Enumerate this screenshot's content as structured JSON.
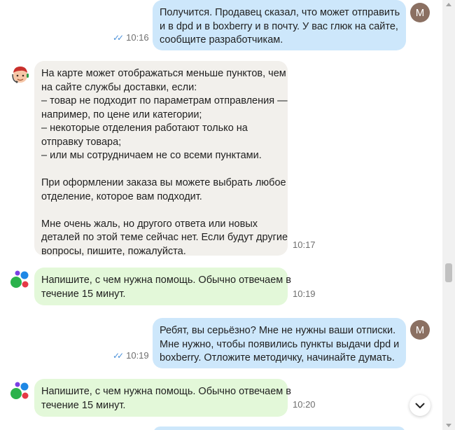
{
  "messages": [
    {
      "sender": "user",
      "avatar_letter": "М",
      "lines": [
        "Получится. Продавец сказал, что может отправить",
        "и в dpd и в boxberry и в почту. У вас глюк на сайте,",
        "сообщите разработчикам."
      ],
      "time": "10:16",
      "status_icon": "double-check-icon"
    },
    {
      "sender": "agent",
      "lines": [
        "На карте может отображаться меньше пунктов, чем",
        "на сайте службы доставки, если:",
        "– товар не подходит по параметрам отправления —",
        "например, по цене или категории;",
        "– некоторые отделения работают только на",
        "отправку товара;",
        "– или мы сотрудничаем не со всеми пунктами.",
        "",
        "При оформлении заказа вы можете выбрать любое",
        "отделение, которое вам подходит.",
        "",
        "Мне очень жаль, но другого ответа или новых",
        "деталей по этой теме сейчас нет. Если будут другие",
        "вопросы, пишите, пожалуйста."
      ],
      "time": "10:17"
    },
    {
      "sender": "service",
      "lines": [
        "Напишите, с чем нужна помощь. Обычно отвечаем в",
        "течение 15 минут."
      ],
      "time": "10:19"
    },
    {
      "sender": "user",
      "avatar_letter": "М",
      "lines": [
        "Ребят, вы серьёзно? Мне не нужны ваши отписки.",
        "Мне нужно, чтобы появились пункты выдачи dpd и",
        "boxberry. Отложите методичку, начинайте думать."
      ],
      "time": "10:19",
      "status_icon": "double-check-icon"
    },
    {
      "sender": "service",
      "lines": [
        "Напишите, с чем нужна помощь. Обычно отвечаем в",
        "течение 15 минут."
      ],
      "time": "10:20"
    }
  ],
  "colors": {
    "outgoing_bubble": "#cde7fb",
    "agent_bubble": "#f2f0ec",
    "service_bubble": "#e3f8d9",
    "read_ticks": "#4a90d9",
    "user_avatar": "#8b7062"
  }
}
